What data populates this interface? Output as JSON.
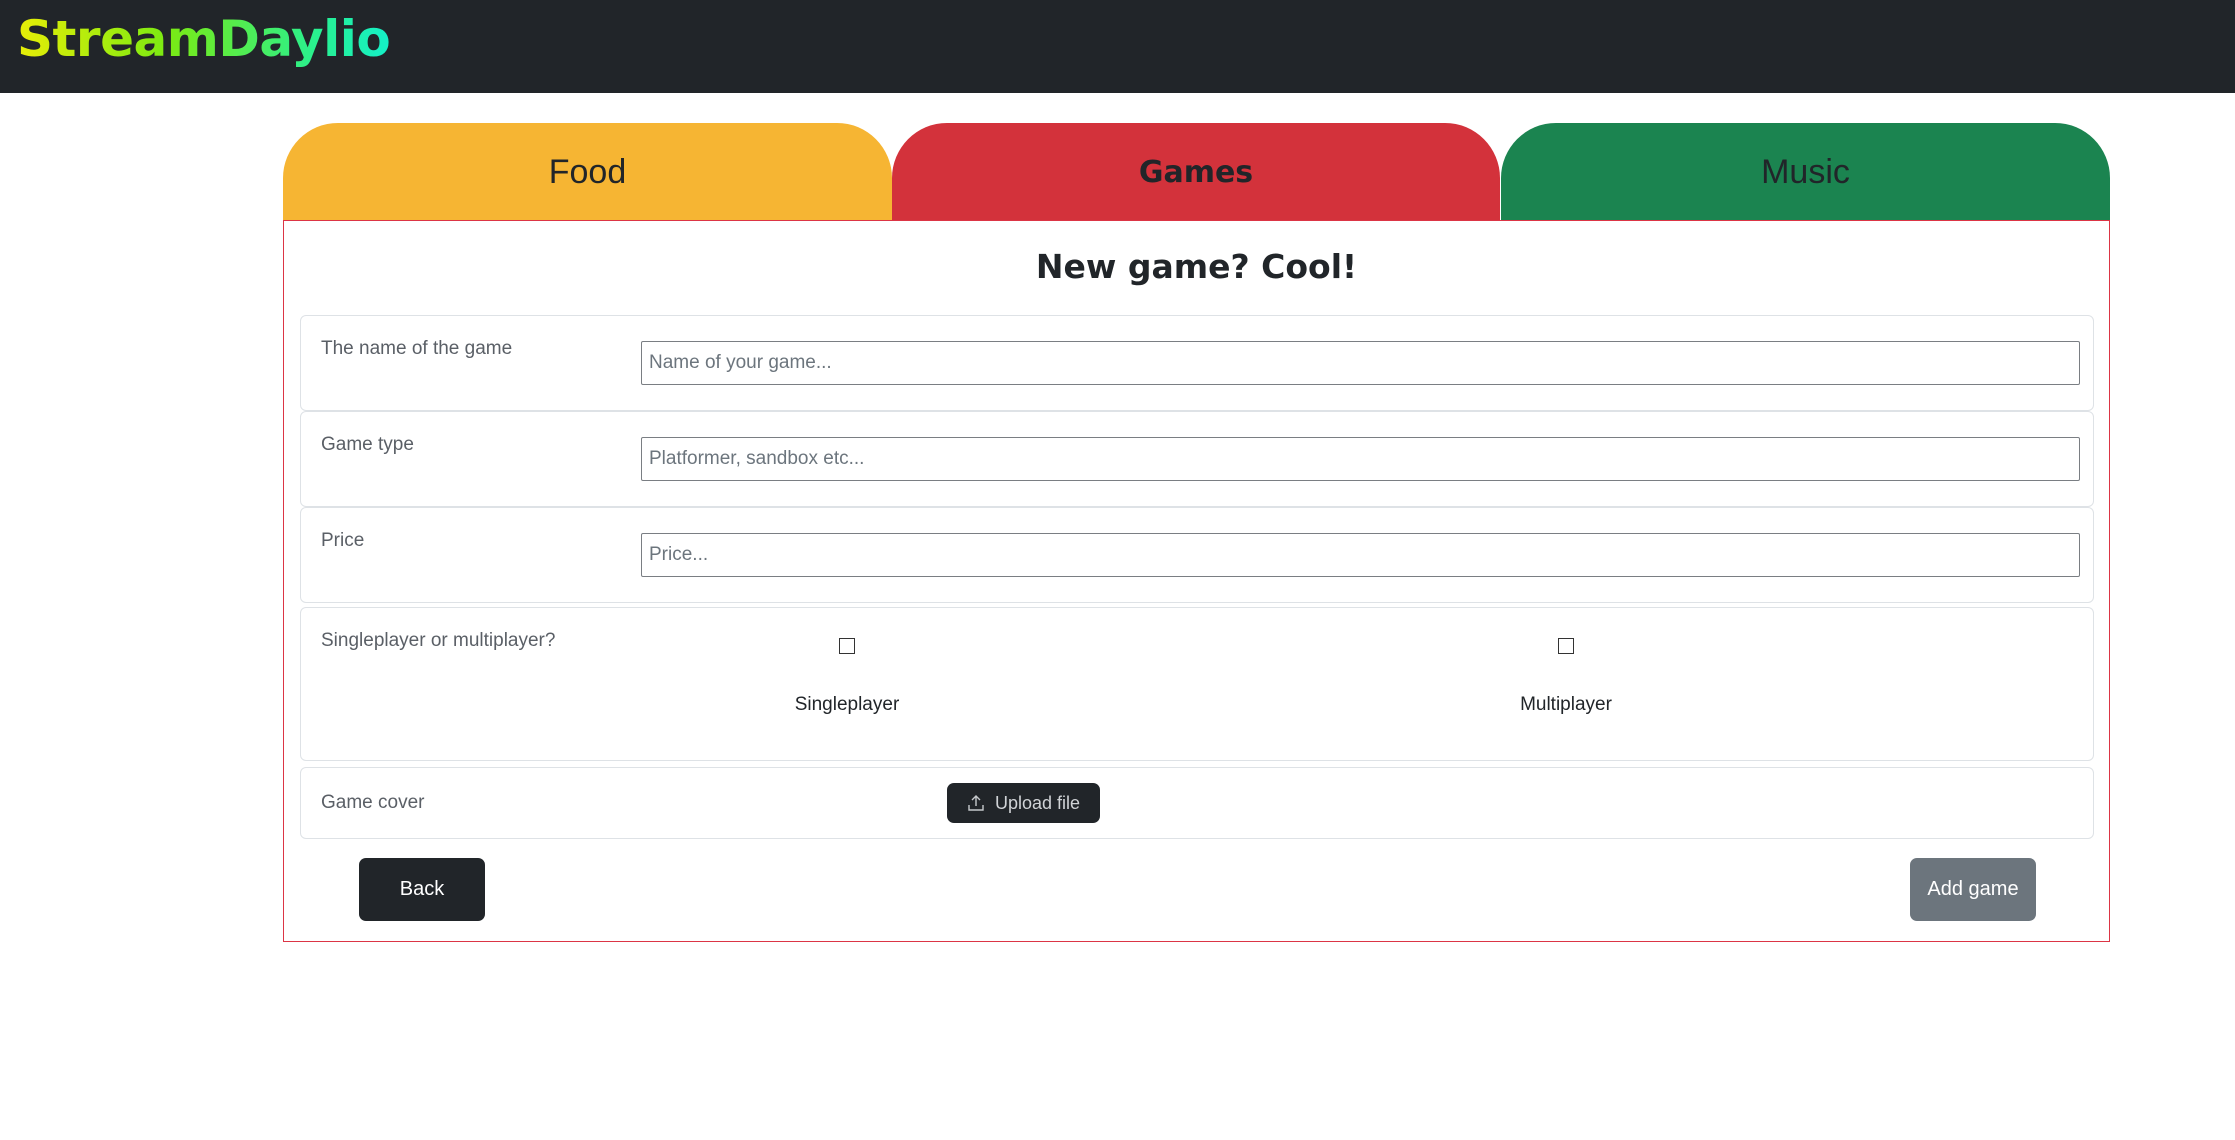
{
  "app": {
    "brand": "StreamDaylio"
  },
  "tabs": [
    {
      "label": "Food",
      "color": "#f6b533"
    },
    {
      "label": "Games",
      "color": "#d3323b",
      "active": true
    },
    {
      "label": "Music",
      "color": "#1b8450"
    }
  ],
  "form": {
    "title": "New game? Cool!",
    "name": {
      "label": "The name of the game",
      "placeholder": "Name of your game...",
      "value": ""
    },
    "type": {
      "label": "Game type",
      "placeholder": "Platformer, sandbox etc...",
      "value": ""
    },
    "price": {
      "label": "Price",
      "placeholder": "Price...",
      "value": ""
    },
    "mode": {
      "label": "Singleplayer or multiplayer?",
      "options": [
        {
          "label": "Singleplayer",
          "checked": false
        },
        {
          "label": "Multiplayer",
          "checked": false
        }
      ]
    },
    "cover": {
      "label": "Game cover",
      "upload_label": "Upload file",
      "icon": "upload-icon"
    },
    "back_label": "Back",
    "add_label": "Add game"
  },
  "colors": {
    "navbar": "#212529",
    "card_border": "#dc3545",
    "secondary": "#6c757d"
  }
}
